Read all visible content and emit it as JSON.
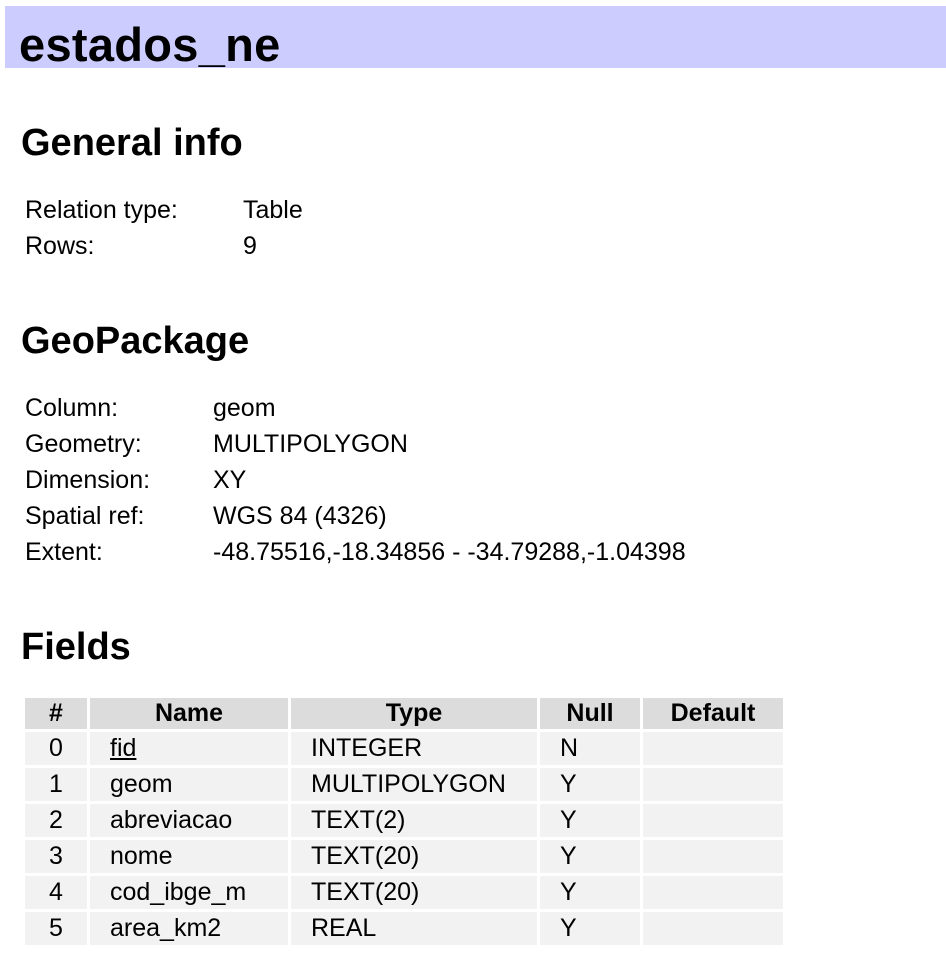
{
  "title": "estados_ne",
  "general": {
    "heading": "General info",
    "rows": [
      {
        "key": "Relation type:",
        "value": "Table"
      },
      {
        "key": "Rows:",
        "value": "9"
      }
    ]
  },
  "geopackage": {
    "heading": "GeoPackage",
    "rows": [
      {
        "key": "Column:",
        "value": "geom"
      },
      {
        "key": "Geometry:",
        "value": "MULTIPOLYGON"
      },
      {
        "key": "Dimension:",
        "value": "XY"
      },
      {
        "key": "Spatial ref:",
        "value": "WGS 84 (4326)"
      },
      {
        "key": "Extent:",
        "value": "-48.75516,-18.34856 - -34.79288,-1.04398"
      }
    ]
  },
  "fields": {
    "heading": "Fields",
    "columns": [
      "#",
      "Name",
      "Type",
      "Null",
      "Default"
    ],
    "rows": [
      {
        "num": "0",
        "name": "fid",
        "type": "INTEGER",
        "null": "N",
        "default": ""
      },
      {
        "num": "1",
        "name": "geom",
        "type": "MULTIPOLYGON",
        "null": "Y",
        "default": ""
      },
      {
        "num": "2",
        "name": "abreviacao",
        "type": "TEXT(2)",
        "null": "Y",
        "default": ""
      },
      {
        "num": "3",
        "name": "nome",
        "type": "TEXT(20)",
        "null": "Y",
        "default": ""
      },
      {
        "num": "4",
        "name": "cod_ibge_m",
        "type": "TEXT(20)",
        "null": "Y",
        "default": ""
      },
      {
        "num": "5",
        "name": "area_km2",
        "type": "REAL",
        "null": "Y",
        "default": ""
      }
    ]
  },
  "colors": {
    "title_background": "#ccccff",
    "header_cell": "#dcdcdc",
    "body_cell": "#f2f2f2"
  }
}
